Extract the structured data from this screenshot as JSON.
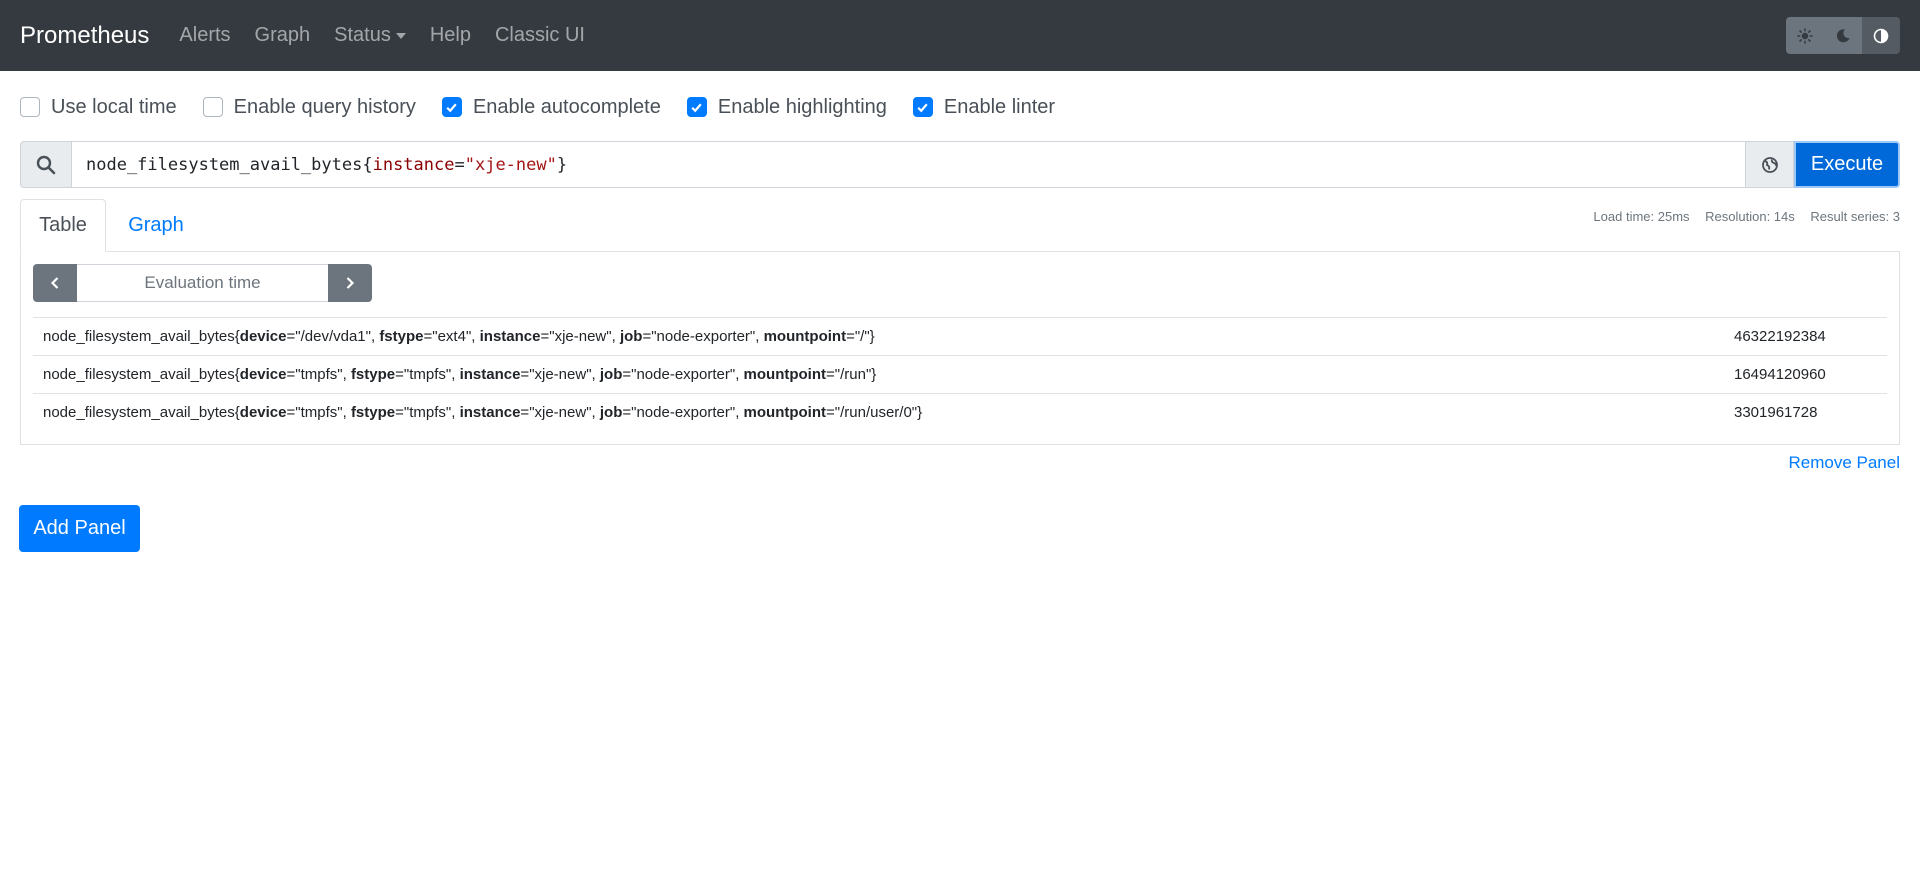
{
  "navbar": {
    "brand": "Prometheus",
    "links": [
      "Alerts",
      "Graph",
      "Status",
      "Help",
      "Classic UI"
    ],
    "theme_buttons": [
      "sun-icon",
      "moon-icon",
      "contrast-icon"
    ]
  },
  "options": [
    {
      "label": "Use local time",
      "checked": false
    },
    {
      "label": "Enable query history",
      "checked": false
    },
    {
      "label": "Enable autocomplete",
      "checked": true
    },
    {
      "label": "Enable highlighting",
      "checked": true
    },
    {
      "label": "Enable linter",
      "checked": true
    }
  ],
  "query": {
    "metric": "node_filesystem_avail_bytes",
    "open_brace": "{",
    "label": "instance",
    "equals": "=",
    "value": "\"xje-new\"",
    "close_brace": "}",
    "execute_label": "Execute"
  },
  "tabs": {
    "table": "Table",
    "graph": "Graph"
  },
  "stats": {
    "load_time": "Load time: 25ms",
    "resolution": "Resolution: 14s",
    "result_series": "Result series: 3"
  },
  "eval": {
    "placeholder": "Evaluation time"
  },
  "results": [
    {
      "metric": "node_filesystem_avail_bytes",
      "labels": [
        {
          "name": "device",
          "value": "\"/dev/vda1\""
        },
        {
          "name": "fstype",
          "value": "\"ext4\""
        },
        {
          "name": "instance",
          "value": "\"xje-new\""
        },
        {
          "name": "job",
          "value": "\"node-exporter\""
        },
        {
          "name": "mountpoint",
          "value": "\"/\""
        }
      ],
      "value": "46322192384"
    },
    {
      "metric": "node_filesystem_avail_bytes",
      "labels": [
        {
          "name": "device",
          "value": "\"tmpfs\""
        },
        {
          "name": "fstype",
          "value": "\"tmpfs\""
        },
        {
          "name": "instance",
          "value": "\"xje-new\""
        },
        {
          "name": "job",
          "value": "\"node-exporter\""
        },
        {
          "name": "mountpoint",
          "value": "\"/run\""
        }
      ],
      "value": "16494120960"
    },
    {
      "metric": "node_filesystem_avail_bytes",
      "labels": [
        {
          "name": "device",
          "value": "\"tmpfs\""
        },
        {
          "name": "fstype",
          "value": "\"tmpfs\""
        },
        {
          "name": "instance",
          "value": "\"xje-new\""
        },
        {
          "name": "job",
          "value": "\"node-exporter\""
        },
        {
          "name": "mountpoint",
          "value": "\"/run/user/0\""
        }
      ],
      "value": "3301961728"
    }
  ],
  "remove_panel": "Remove Panel",
  "add_panel": "Add Panel"
}
